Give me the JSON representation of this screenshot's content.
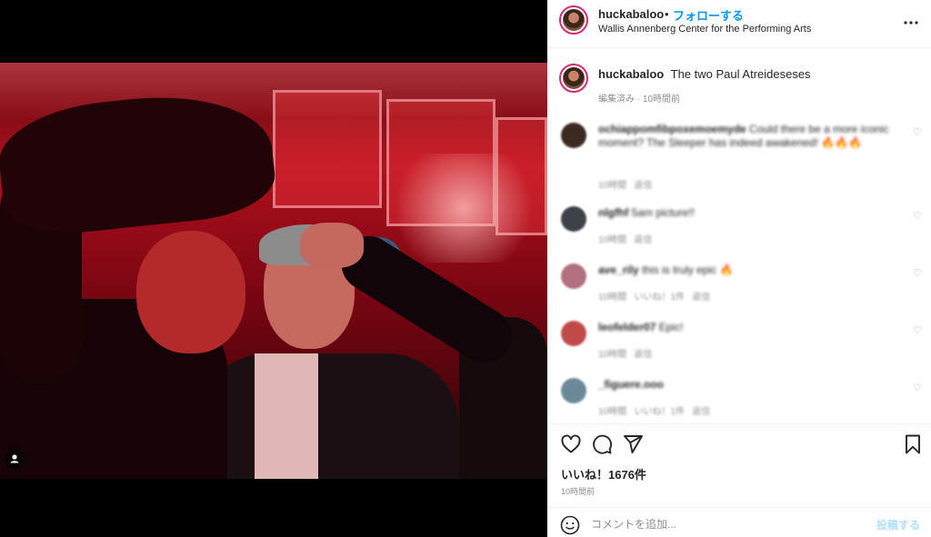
{
  "header": {
    "username": "huckabaloo",
    "separator": "•",
    "follow_label": "フォローする",
    "location": "Wallis Annenberg Center for the Performing Arts",
    "more_icon": "more-horizontal-icon"
  },
  "caption": {
    "username": "huckabaloo",
    "text": "The two Paul Atreideseses",
    "meta": "編集済み · 10時間前"
  },
  "comments": [
    {
      "user": "ochiappomfibpoxemoemyde",
      "text": "Could there be a more iconic moment? The Sleeper has indeed awakened!",
      "highlight": "🔥🔥🔥",
      "meta1": "10時間",
      "meta2": "返信",
      "avatar_color": "#3a2a20"
    },
    {
      "user": "nlgfhf",
      "text": "5am picture!!",
      "highlight": "",
      "meta1": "10時間",
      "meta2": "返信",
      "avatar_color": "#3d4148"
    },
    {
      "user": "ave_rily",
      "text": "this is truly epic",
      "highlight": "🔥",
      "meta1": "10時間",
      "meta2": "いいね！1件",
      "meta3": "返信",
      "avatar_color": "#b07080"
    },
    {
      "user": "leofelder07",
      "text": "Epic!",
      "highlight": "",
      "meta1": "10時間",
      "meta2": "返信",
      "avatar_color": "#c04a4a"
    },
    {
      "user": "_figuere.ooo",
      "text": "",
      "highlight": "",
      "meta1": "10時間",
      "meta2": "いいね！1件",
      "meta3": "返信",
      "avatar_color": "#6a8a9a"
    }
  ],
  "actions": {
    "likes": "いいね！1676件",
    "time": "10時間前"
  },
  "add_comment": {
    "placeholder": "コメントを追加...",
    "post_label": "投稿する"
  },
  "colors": {
    "accent": "#0095f6",
    "post_disabled": "#b2dffc",
    "highlight": "#e8793a"
  }
}
